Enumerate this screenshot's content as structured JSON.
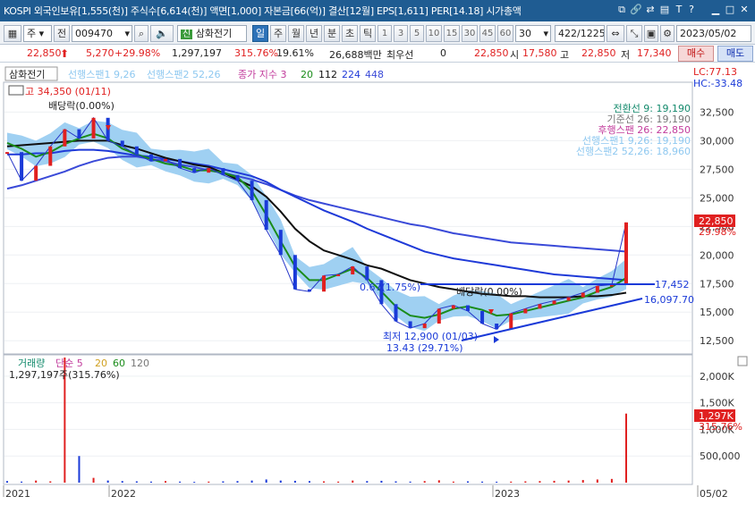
{
  "titlebar": {
    "text": "KOSPI 외국인보유[1,555(천)] 주식수[6,614(천)] 액면[1,000] 자본금[66(억)] 결산[12월] EPS[1,611] PER[14.18] 시가총액",
    "icons": [
      "copy-icon",
      "link-icon",
      "swap-icon",
      "memo-icon",
      "settings-icon",
      "text-icon",
      "help-icon",
      "minimize-icon",
      "maximize-icon",
      "close-icon"
    ]
  },
  "toolbar": {
    "left_menu": "▦",
    "market": "주",
    "prev_label": "전",
    "stock_code": "009470",
    "stock_name": "삼화전기",
    "name_badge": "신",
    "periods": [
      "일",
      "주",
      "월",
      "년",
      "분",
      "초",
      "틱"
    ],
    "selected_period": "일",
    "minutes": [
      "1",
      "3",
      "5",
      "10",
      "15",
      "30",
      "45",
      "60"
    ],
    "count": "30",
    "page_counter": "422/1225",
    "date": "2023/05/02"
  },
  "pricebar": {
    "price": "22,850",
    "change": "5,270",
    "change_pct": "+29.98%",
    "volume": "1,297,197",
    "volume_pct": "315.76%",
    "turnover": "19.61%",
    "amount": "26,688백만",
    "best_label": "최우선",
    "best_value": "0",
    "best_price": "22,850",
    "open_label": "시",
    "open": "17,580",
    "high_label": "고",
    "high": "22,850",
    "low_label": "저",
    "low": "17,340",
    "sell_label": "매수",
    "buy_label": "매도"
  },
  "chart_data": {
    "type": "line",
    "title": "삼화전기",
    "legend_top": [
      "삼화전기",
      "선행스팬1 9,26",
      "선행스팬2 52,26",
      "종가 지수 3",
      "20",
      "112",
      "224",
      "448"
    ],
    "lc": "LC:77.13",
    "hc": "HC:-33.48",
    "price_axis": {
      "ticks": [
        12500,
        15000,
        17500,
        20000,
        22500,
        25000,
        27500,
        30000,
        32500
      ],
      "labels": [
        "12,500",
        "15,000",
        "17,500",
        "20,000",
        "22,500",
        "25,000",
        "27,500",
        "30,000",
        "32,500"
      ],
      "ylim": [
        11500,
        34800
      ]
    },
    "current_price": {
      "label": "22,850",
      "pct": "29.98%",
      "value": 22850
    },
    "ichimoku_legend": [
      {
        "label": "전환선 9: 19,190",
        "color": "#138a6c"
      },
      {
        "label": "기준선 26: 19,190",
        "color": "#777777"
      },
      {
        "label": "후행스팬 26: 22,850",
        "color": "#c23c9c"
      },
      {
        "label": "선행스팬1 9,26: 19,190",
        "color": "#8ec8f0"
      },
      {
        "label": "선행스팬2 52,26: 18,960",
        "color": "#8ec8f0"
      }
    ],
    "annotations": {
      "high": "고 34,350 (01/11)",
      "low": "최저 12,900 (01/03)",
      "low_pct": "13.43 (29.71%)",
      "dividend1": "배당락(0.00%)",
      "dividend2": "배당락(0.00%)",
      "line1_pct": "0.67(1.75%)",
      "line1_value": "17,452",
      "line2_value": "16,097.70"
    },
    "volume_panel": {
      "legend": [
        "거래량",
        "단순 5",
        "20",
        "60",
        "120"
      ],
      "volume_text": "1,297,197주(315.76%)",
      "ticks": [
        500000,
        1000000,
        1500000,
        2000000
      ],
      "labels": [
        "500,000",
        "1,000K",
        "1,500K",
        "2,000K"
      ],
      "current_label": "1,297K",
      "current_pct": "315.76%",
      "ylim": [
        0,
        2350000
      ]
    },
    "x_labels": [
      "2021",
      "2022",
      "2023",
      "05/02"
    ],
    "series_close": [
      29000,
      26500,
      27800,
      29500,
      31000,
      30200,
      32000,
      30000,
      29500,
      28800,
      28200,
      28400,
      27600,
      27200,
      27600,
      27000,
      26500,
      24800,
      22200,
      20000,
      17000,
      16800,
      18200,
      18300,
      19000,
      17800,
      15700,
      14200,
      13600,
      14000,
      15300,
      15600,
      15100,
      14000,
      13500,
      14900,
      15300,
      15700,
      16000,
      16300,
      16700,
      17300,
      17400,
      22850
    ],
    "ma20": [
      29800,
      29300,
      28600,
      29000,
      29700,
      30200,
      30600,
      30200,
      29300,
      28800,
      28400,
      28000,
      27800,
      27400,
      27400,
      27200,
      26800,
      25600,
      23500,
      21200,
      19000,
      17800,
      17800,
      18300,
      18800,
      18000,
      16800,
      15500,
      14700,
      14500,
      14800,
      15300,
      15500,
      15200,
      14700,
      14800,
      15100,
      15400,
      15700,
      16000,
      16300,
      16800,
      17200,
      18000
    ],
    "ma112": [
      29500,
      29600,
      29700,
      29800,
      29900,
      30000,
      30000,
      30000,
      29600,
      29300,
      28900,
      28500,
      28200,
      27900,
      27700,
      27200,
      26600,
      26000,
      25100,
      23800,
      22300,
      21200,
      20400,
      20000,
      19600,
      19100,
      18800,
      18300,
      17800,
      17500,
      17200,
      17000,
      16800,
      16600,
      16500,
      16400,
      16400,
      16300,
      16300,
      16300,
      16400,
      16400,
      16500,
      16700
    ],
    "ma224": [
      28800,
      28800,
      28900,
      28900,
      29100,
      29200,
      29200,
      29100,
      28900,
      28700,
      28600,
      28400,
      28200,
      28000,
      27800,
      27500,
      27200,
      26900,
      26400,
      25700,
      25100,
      24500,
      23900,
      23400,
      22900,
      22300,
      21800,
      21300,
      20800,
      20300,
      20000,
      19700,
      19500,
      19300,
      19100,
      18900,
      18700,
      18500,
      18300,
      18200,
      18100,
      18000,
      17900,
      17800
    ],
    "ma448": [
      25800,
      26100,
      26500,
      26900,
      27300,
      27800,
      28200,
      28500,
      28600,
      28600,
      28400,
      28200,
      27900,
      27700,
      27400,
      27200,
      26900,
      26600,
      26200,
      25700,
      25200,
      24800,
      24500,
      24200,
      23900,
      23600,
      23300,
      23000,
      22700,
      22500,
      22200,
      21900,
      21700,
      21500,
      21300,
      21100,
      21000,
      20900,
      20800,
      20700,
      20600,
      20500,
      20400,
      20300
    ],
    "volume": [
      30000,
      20000,
      40000,
      25000,
      2350000,
      500000,
      90000,
      40000,
      30000,
      25000,
      20000,
      30000,
      20000,
      15000,
      20000,
      25000,
      30000,
      40000,
      60000,
      40000,
      35000,
      30000,
      25000,
      20000,
      40000,
      30000,
      35000,
      25000,
      20000,
      30000,
      45000,
      20000,
      25000,
      20000,
      18000,
      20000,
      25000,
      30000,
      35000,
      40000,
      50000,
      60000,
      70000,
      1297197
    ]
  },
  "colors": {
    "title_bg": "#1f5c92",
    "cloud": "#8ec8f0",
    "close_line": "#2535c8",
    "ma20": "#1a8c1a",
    "ma112": "#101010",
    "ma224": "#1f3ad8",
    "ma448": "#3a4ad8",
    "price_up": "#e02020",
    "price_down": "#1a3ad8"
  }
}
